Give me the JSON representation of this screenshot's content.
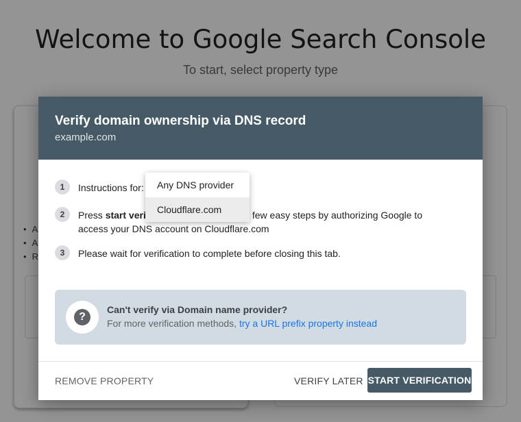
{
  "background": {
    "title": "Welcome to Google Search Console",
    "subtitle": "To start, select property type",
    "bullets": [
      "A",
      "A",
      "R"
    ]
  },
  "dialog": {
    "title": "Verify domain ownership via DNS record",
    "domain": "example.com",
    "steps": [
      {
        "num": "1",
        "text": "Instructions for:"
      },
      {
        "num": "2",
        "pre": "Press ",
        "bold": "start verif",
        "post": "ith a few easy steps by authorizing Google to",
        "line2": "access your DNS account on Cloudflare.com"
      },
      {
        "num": "3",
        "text": "Please wait for verification to complete before closing this tab."
      }
    ],
    "provider_menu": {
      "options": [
        "Any DNS provider",
        "Cloudflare.com"
      ],
      "selected": "Cloudflare.com"
    },
    "info": {
      "icon": "help-icon",
      "title": "Can't verify via Domain name provider?",
      "text": "For more verification methods, ",
      "link": "try a URL prefix property instead"
    },
    "footer": {
      "remove": "REMOVE PROPERTY",
      "later": "VERIFY LATER",
      "start": "START VERIFICATION"
    }
  },
  "colors": {
    "header": "#455a64",
    "link": "#1a73e8",
    "info_bg": "#d1dce2"
  }
}
